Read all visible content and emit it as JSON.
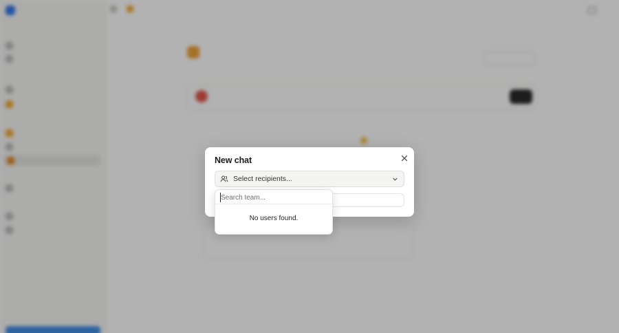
{
  "dialog": {
    "title": "New chat",
    "recipients_placeholder": "Select recipients...",
    "search_placeholder": "Search team...",
    "empty_message": "No users found."
  },
  "icons": {
    "close": "close-icon",
    "recipients": "users-icon",
    "dropdown": "chevron-down-icon"
  },
  "colors": {
    "overlay": "#00000050",
    "dialog_background": "#ffffff"
  }
}
